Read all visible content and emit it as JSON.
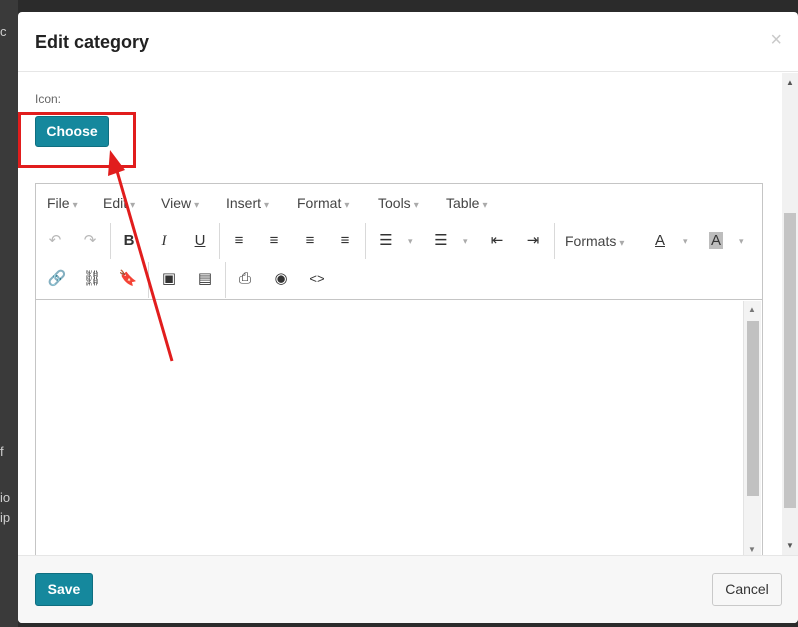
{
  "background": {
    "fragments": [
      "c",
      "f",
      "io",
      "ip"
    ]
  },
  "dialog": {
    "title": "Edit category",
    "close_glyph": "×"
  },
  "icon_field": {
    "label": "Icon:",
    "choose_label": "Choose"
  },
  "editor": {
    "menu": [
      {
        "label": "File"
      },
      {
        "label": "Edit"
      },
      {
        "label": "View"
      },
      {
        "label": "Insert"
      },
      {
        "label": "Format"
      },
      {
        "label": "Tools"
      },
      {
        "label": "Table"
      }
    ],
    "caret_glyph": "▾",
    "formats_label": "Formats",
    "glyphs": {
      "undo": "↶",
      "redo": "↷",
      "bold": "B",
      "italic": "I",
      "underline": "U",
      "align_left": "≡",
      "align_center": "≡",
      "align_right": "≡",
      "justify": "≡",
      "bullet_list": "☰",
      "numbered_list": "☰",
      "outdent": "⇤",
      "indent": "⇥",
      "text_color": "A",
      "bg_color": "A",
      "link": "🔗",
      "unlink": "⛓",
      "anchor": "🔖",
      "image": "▣",
      "media": "▤",
      "print": "⎙",
      "preview": "◉",
      "code": "<>",
      "scroll_up": "▲",
      "scroll_down": "▼"
    },
    "colors": {
      "accent": "#15889d",
      "highlight": "#e11d1d"
    }
  },
  "footer": {
    "save_label": "Save",
    "cancel_label": "Cancel"
  }
}
